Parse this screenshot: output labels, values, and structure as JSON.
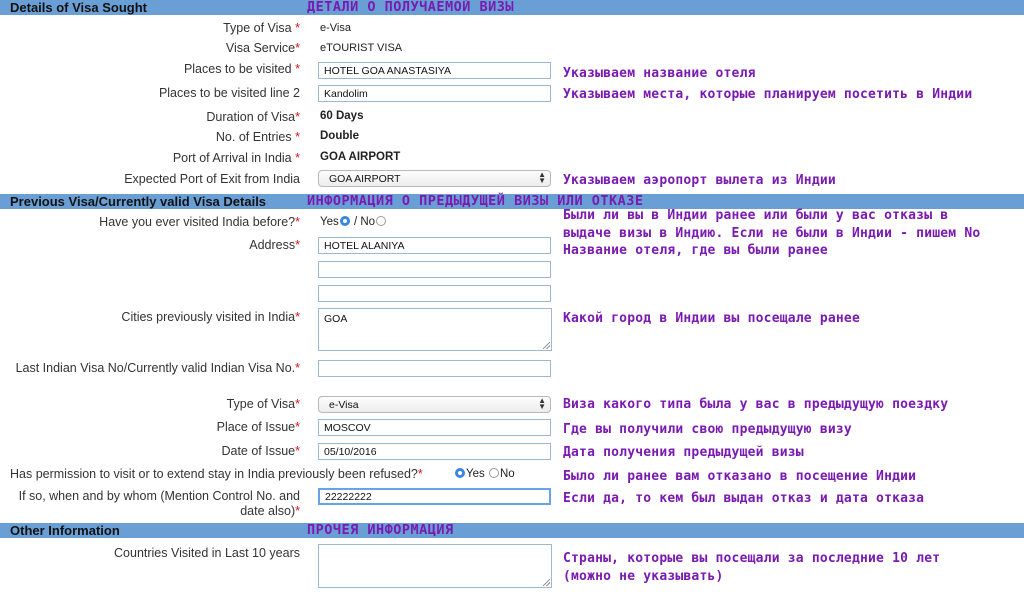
{
  "sections": {
    "visa": {
      "title": "Details of Visa Sought",
      "ru": "ДЕТАЛИ О ПОЛУЧАЕМОЙ ВИЗЫ"
    },
    "previous": {
      "title": "Previous Visa/Currently valid Visa Details",
      "ru": "ИНФОРМАЦИЯ О ПРЕДЫДУЩЕЙ ВИЗЫ ИЛИ ОТКАЗЕ"
    },
    "other": {
      "title": "Other Information",
      "ru": "ПРОЧЕЯ ИНФОРМАЦИЯ"
    }
  },
  "visa": {
    "type_label": "Type of Visa",
    "type_value": "e-Visa",
    "service_label": "Visa Service",
    "service_value": "eTOURIST VISA",
    "places_label": "Places to be visited",
    "places_value": "HOTEL GOA ANASTASIYA",
    "places2_label": "Places to be visited line 2",
    "places2_value": "Kandolim",
    "duration_label": "Duration of Visa",
    "duration_value": "60 Days",
    "entries_label": "No. of Entries",
    "entries_value": "Double",
    "arrival_label": "Port of Arrival in India",
    "arrival_value": "GOA AIRPORT",
    "exit_label": "Expected Port of Exit from India",
    "exit_value": "GOA AIRPORT"
  },
  "previous": {
    "visited_label": "Have you ever visited India before?",
    "yes": "Yes",
    "no": "/ No",
    "address_label": "Address",
    "address_value": "HOTEL ALANIYA",
    "cities_label": "Cities previously visited in India",
    "cities_value": "GOA",
    "last_visa_label": "Last Indian Visa No/Currently valid Indian Visa No.",
    "type_label": "Type of Visa",
    "type_value": "e-Visa",
    "place_issue_label": "Place of Issue",
    "place_issue_value": "MOSCOV",
    "date_issue_label": "Date of Issue",
    "date_issue_value": "05/10/2016",
    "refused_label": "Has permission to visit or to extend stay in India previously been refused?",
    "refused_yes": "Yes",
    "refused_no": "No",
    "ifso_label": "If so, when and by whom (Mention Control No. and date also)",
    "ifso_value": "22222222"
  },
  "other": {
    "countries_label": "Countries Visited in Last 10 years"
  },
  "notes": {
    "places": "Указываем название отеля",
    "places2": "Указываем места, которые планируем посетить в Индии",
    "exit": "Указываем аэропорт вылета из Индии",
    "visited_1": "Были ли вы в Индии ранее или были у вас отказы в",
    "visited_2": "выдаче визы в Индию. Если не были в Индии - пишем No",
    "visited_3": "Название отеля, где вы были ранее",
    "cities": "Какой город в Индии вы посещале ранее",
    "type": "Виза какого типа была у вас в предыдущую поездку",
    "place_issue": "Где вы получили свою предыдущую визу",
    "date_issue": "Дата получения предыдущей визы",
    "refused": "Было ли ранее вам отказано в посещение Индии",
    "ifso": "Если да, то кем был выдан отказ и дата отказа",
    "countries_1": "Страны, которые вы посещали за последние 10 лет",
    "countries_2": "(можно не указывать)"
  },
  "icons": {
    "select_arrows": "▲▼"
  },
  "colors": {
    "section_bar": "#6a9fd6",
    "annotation": "#7a1ab0",
    "required": "#d11111",
    "radio_on": "#3b86e0"
  }
}
